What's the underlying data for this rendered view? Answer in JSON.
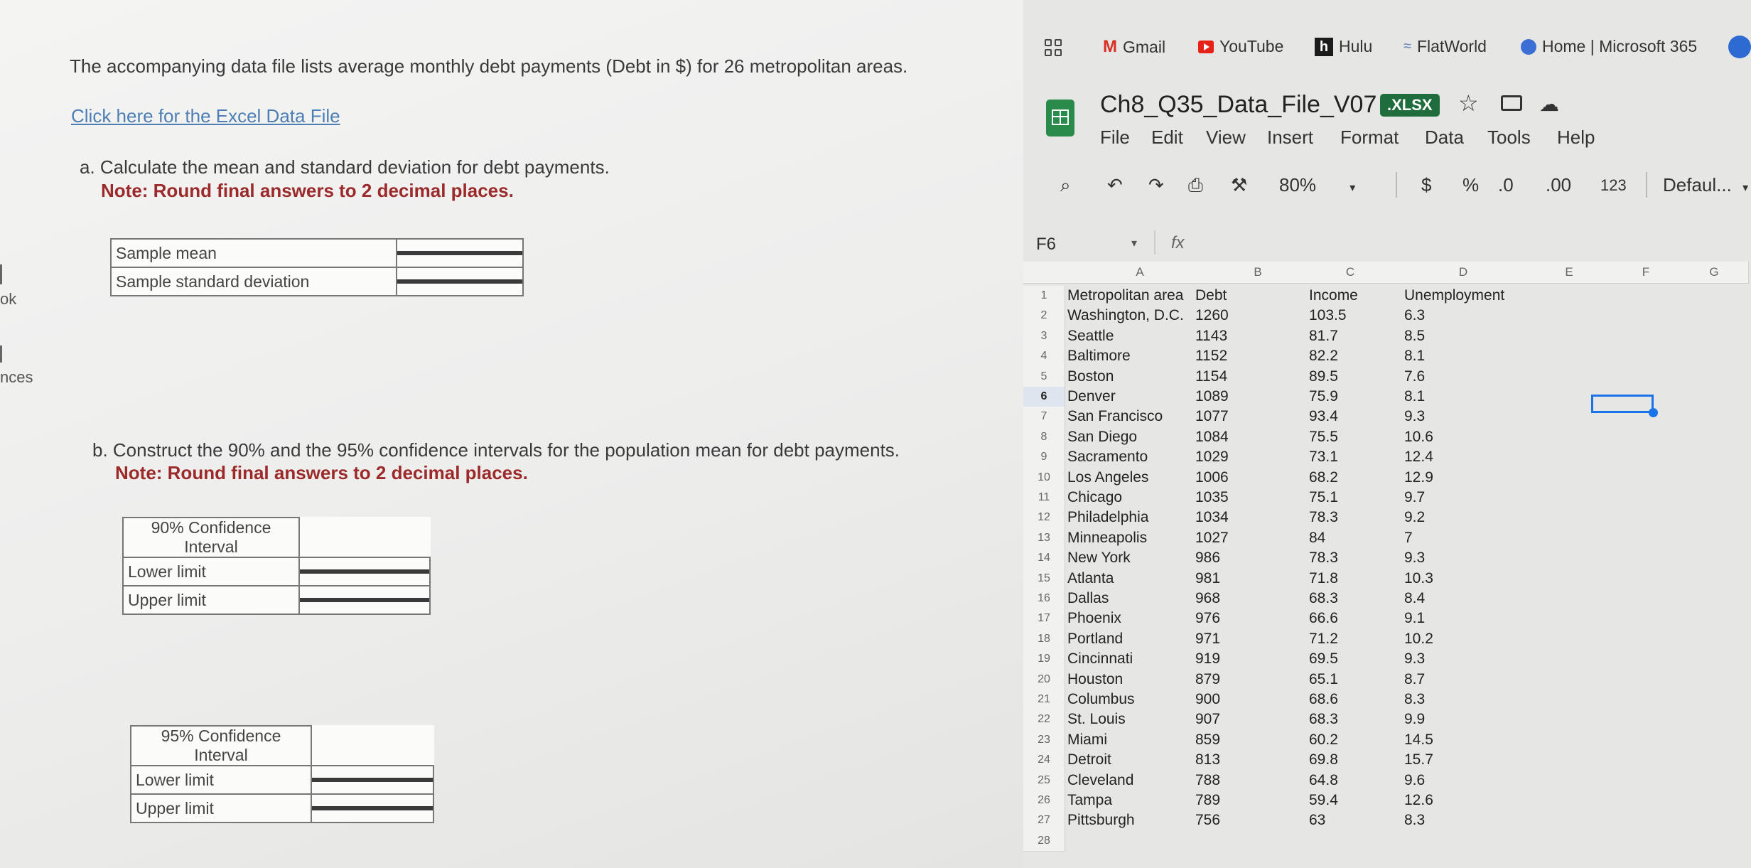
{
  "homework": {
    "intro": "The accompanying data file lists average monthly debt payments (Debt in $) for 26 metropolitan areas.",
    "excel_link": "Click here for the Excel Data File",
    "part_a": {
      "question": "a. Calculate the mean and standard deviation for debt payments.",
      "note": "Note: Round final answers to 2 decimal places.",
      "rows": [
        "Sample mean",
        "Sample standard deviation"
      ]
    },
    "part_b": {
      "question": "b. Construct the 90% and the 95% confidence intervals for the population mean for debt payments.",
      "note": "Note: Round final answers to 2 decimal places."
    },
    "ci90": {
      "header": "90% Confidence Interval",
      "lower": "Lower limit",
      "upper": "Upper limit"
    },
    "ci95": {
      "header": "95% Confidence Interval",
      "lower": "Lower limit",
      "upper": "Upper limit"
    },
    "edge": {
      "ok": "ok",
      "nces": "nces"
    }
  },
  "browser": {
    "bookmarks": [
      "Gmail",
      "YouTube",
      "Hulu",
      "FlatWorld",
      "Home | Microsoft 365"
    ],
    "doc_title": "Ch8_Q35_Data_File_V07",
    "badge": ".XLSX",
    "menu": [
      "File",
      "Edit",
      "View",
      "Insert",
      "Format",
      "Data",
      "Tools",
      "Help"
    ],
    "toolbar": {
      "zoom": "80%",
      "currency": "$",
      "percent": "%",
      "dec_less": ".0",
      "dec_more": ".00",
      "number": "123",
      "font": "Defaul..."
    },
    "name_box": "F6",
    "fx": "fx"
  },
  "sheet": {
    "columns": [
      "A",
      "B",
      "C",
      "D",
      "E",
      "F",
      "G"
    ],
    "rows": [
      [
        "Metropolitan area",
        "Debt",
        "Income",
        "Unemployment"
      ],
      [
        "Washington, D.C.",
        "1260",
        "103.5",
        "6.3"
      ],
      [
        "Seattle",
        "1143",
        "81.7",
        "8.5"
      ],
      [
        "Baltimore",
        "1152",
        "82.2",
        "8.1"
      ],
      [
        "Boston",
        "1154",
        "89.5",
        "7.6"
      ],
      [
        "Denver",
        "1089",
        "75.9",
        "8.1"
      ],
      [
        "San Francisco",
        "1077",
        "93.4",
        "9.3"
      ],
      [
        "San Diego",
        "1084",
        "75.5",
        "10.6"
      ],
      [
        "Sacramento",
        "1029",
        "73.1",
        "12.4"
      ],
      [
        "Los Angeles",
        "1006",
        "68.2",
        "12.9"
      ],
      [
        "Chicago",
        "1035",
        "75.1",
        "9.7"
      ],
      [
        "Philadelphia",
        "1034",
        "78.3",
        "9.2"
      ],
      [
        "Minneapolis",
        "1027",
        "84",
        "7"
      ],
      [
        "New York",
        "986",
        "78.3",
        "9.3"
      ],
      [
        "Atlanta",
        "981",
        "71.8",
        "10.3"
      ],
      [
        "Dallas",
        "968",
        "68.3",
        "8.4"
      ],
      [
        "Phoenix",
        "976",
        "66.6",
        "9.1"
      ],
      [
        "Portland",
        "971",
        "71.2",
        "10.2"
      ],
      [
        "Cincinnati",
        "919",
        "69.5",
        "9.3"
      ],
      [
        "Houston",
        "879",
        "65.1",
        "8.7"
      ],
      [
        "Columbus",
        "900",
        "68.6",
        "8.3"
      ],
      [
        "St. Louis",
        "907",
        "68.3",
        "9.9"
      ],
      [
        "Miami",
        "859",
        "60.2",
        "14.5"
      ],
      [
        "Detroit",
        "813",
        "69.8",
        "15.7"
      ],
      [
        "Cleveland",
        "788",
        "64.8",
        "9.6"
      ],
      [
        "Tampa",
        "789",
        "59.4",
        "12.6"
      ],
      [
        "Pittsburgh",
        "756",
        "63",
        "8.3"
      ],
      [
        "",
        "",
        "",
        ""
      ]
    ]
  }
}
